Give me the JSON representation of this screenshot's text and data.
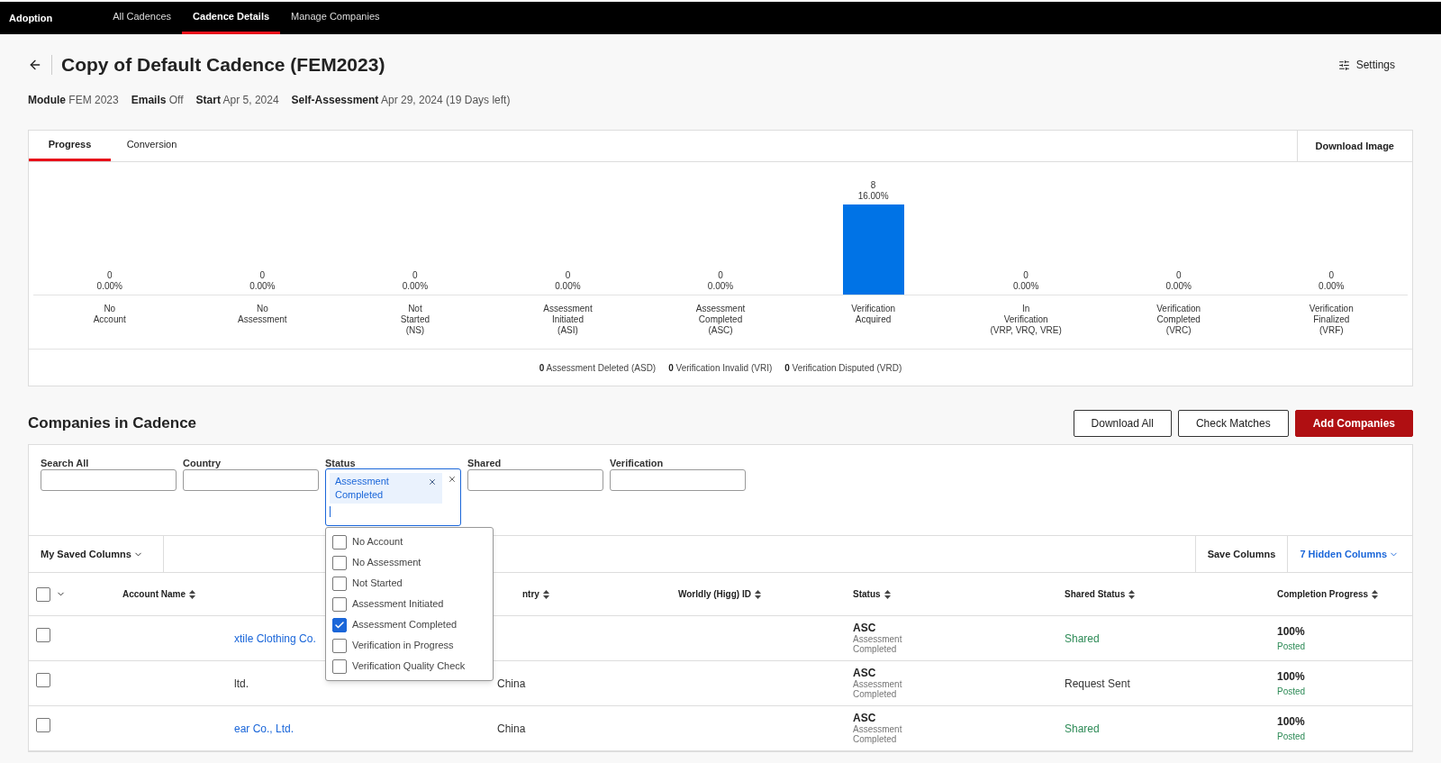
{
  "nav": {
    "brand": "Adoption",
    "tabs": [
      {
        "label": "All Cadences",
        "selected": false
      },
      {
        "label": "Cadence Details",
        "selected": true
      },
      {
        "label": "Manage Companies",
        "selected": false
      }
    ]
  },
  "page": {
    "title": "Copy of Default Cadence (FEM2023)",
    "settings": "Settings",
    "meta": [
      {
        "label": "Module",
        "value": "FEM 2023"
      },
      {
        "label": "Emails",
        "value": "Off"
      },
      {
        "label": "Start",
        "value": "Apr 5, 2024"
      },
      {
        "label": "Self-Assessment",
        "value": "Apr 29, 2024 (19 Days left)"
      }
    ]
  },
  "progress_card": {
    "tabs": [
      {
        "label": "Progress",
        "selected": true
      },
      {
        "label": "Conversion",
        "selected": false
      }
    ],
    "download": "Download Image",
    "chart_data": {
      "type": "bar",
      "categories": [
        "No\nAccount",
        "No\nAssessment",
        "Not\nStarted\n(NS)",
        "Assessment\nInitiated\n(ASI)",
        "Assessment\nCompleted\n(ASC)",
        "Verification\nAcquired",
        "In\nVerification\n(VRP, VRQ, VRE)",
        "Verification\nCompleted\n(VRC)",
        "Verification\nFinalized\n(VRF)"
      ],
      "values": [
        0,
        0,
        0,
        0,
        0,
        8,
        0,
        0,
        0
      ],
      "value_labels": [
        "0\n0.00%",
        "0\n0.00%",
        "0\n0.00%",
        "0\n0.00%",
        "0\n0.00%",
        "8\n16.00%",
        "0\n0.00%",
        "0\n0.00%",
        "0\n0.00%"
      ]
    },
    "footer": [
      {
        "count": "0",
        "label": "Assessment Deleted (ASD)"
      },
      {
        "count": "0",
        "label": "Verification Invalid (VRI)"
      },
      {
        "count": "0",
        "label": "Verification Disputed (VRD)"
      }
    ]
  },
  "companies": {
    "title": "Companies in Cadence",
    "buttons": [
      {
        "label": "Download All",
        "kind": "outline"
      },
      {
        "label": "Check Matches",
        "kind": "outline"
      },
      {
        "label": "Add Companies",
        "kind": "primary"
      }
    ],
    "filters": [
      {
        "label": "Search All"
      },
      {
        "label": "Country"
      },
      {
        "label": "Status",
        "tags": [
          "Assessment Completed"
        ],
        "focused": true
      },
      {
        "label": "Shared"
      },
      {
        "label": "Verification"
      }
    ],
    "status_options": [
      {
        "label": "No Account",
        "checked": false
      },
      {
        "label": "No Assessment",
        "checked": false
      },
      {
        "label": "Not Started",
        "checked": false
      },
      {
        "label": "Assessment Initiated",
        "checked": false
      },
      {
        "label": "Assessment Completed",
        "checked": true
      },
      {
        "label": "Verification in Progress",
        "checked": false
      },
      {
        "label": "Verification Quality Check",
        "checked": false
      }
    ],
    "saved_columns": "My Saved Columns",
    "save_columns": "Save Columns",
    "hidden_columns": "7 Hidden Columns",
    "table": {
      "select_all": {
        "checked": false
      },
      "columns": [
        "Account Name",
        "ntry",
        "Worldly (Higg) ID",
        "Status",
        "Shared Status",
        "Completion Progress"
      ],
      "rows": [
        {
          "checked": false,
          "account_name": "xtile Clothing Co.",
          "account_link": true,
          "status_code": "ASC",
          "status_label": "Assessment Completed",
          "shared_status": {
            "text": "Shared",
            "color": "#2e8b57"
          },
          "progress": "100%",
          "progress_label": "Posted"
        },
        {
          "checked": false,
          "account_name": "ltd.",
          "account_link": false,
          "country": "China",
          "status_code": "ASC",
          "status_label": "Assessment Completed",
          "shared_status": {
            "text": "Request Sent",
            "color": "#333333"
          },
          "progress": "100%",
          "progress_label": "Posted"
        },
        {
          "checked": false,
          "account_name": "ear Co., Ltd.",
          "account_link": true,
          "country": "China",
          "status_code": "ASC",
          "status_label": "Assessment Completed",
          "shared_status": {
            "text": "Shared",
            "color": "#2e8b57"
          },
          "progress": "100%",
          "progress_label": "Posted"
        }
      ]
    }
  }
}
